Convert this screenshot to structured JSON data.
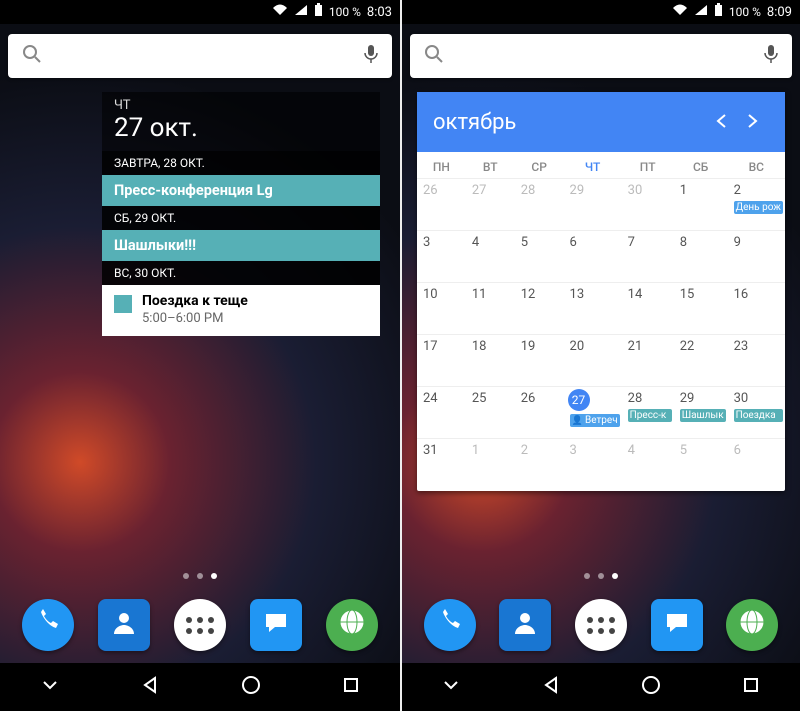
{
  "left": {
    "status": {
      "battery": "100 %",
      "time": "8:03"
    },
    "agenda": {
      "header_dow": "ЧТ",
      "header_date": "27 окт.",
      "sections": [
        {
          "label": "ЗАВТРА, 28 ОКТ.",
          "events": [
            {
              "type": "bar",
              "title": "Пресс-конференция Lg"
            }
          ]
        },
        {
          "label": "СБ, 29 ОКТ.",
          "events": [
            {
              "type": "bar",
              "title": "Шашлыки!!!"
            }
          ]
        },
        {
          "label": "ВС, 30 ОКТ.",
          "events": [
            {
              "type": "card",
              "title": "Поездка к теще",
              "time": "5:00–6:00 PM"
            }
          ]
        }
      ]
    }
  },
  "right": {
    "status": {
      "battery": "100 %",
      "time": "8:09"
    },
    "month": {
      "title": "октябрь",
      "weekdays": [
        "ПН",
        "ВТ",
        "СР",
        "ЧТ",
        "ПТ",
        "СБ",
        "ВС"
      ],
      "today_col": 3,
      "weeks": [
        [
          {
            "n": "26",
            "o": true
          },
          {
            "n": "27",
            "o": true
          },
          {
            "n": "28",
            "o": true
          },
          {
            "n": "29",
            "o": true
          },
          {
            "n": "30",
            "o": true
          },
          {
            "n": "1"
          },
          {
            "n": "2",
            "chips": [
              {
                "t": "День рож",
                "c": "blue"
              }
            ]
          }
        ],
        [
          {
            "n": "3"
          },
          {
            "n": "4"
          },
          {
            "n": "5"
          },
          {
            "n": "6"
          },
          {
            "n": "7"
          },
          {
            "n": "8"
          },
          {
            "n": "9"
          }
        ],
        [
          {
            "n": "10"
          },
          {
            "n": "11"
          },
          {
            "n": "12"
          },
          {
            "n": "13"
          },
          {
            "n": "14"
          },
          {
            "n": "15"
          },
          {
            "n": "16"
          }
        ],
        [
          {
            "n": "17"
          },
          {
            "n": "18"
          },
          {
            "n": "19"
          },
          {
            "n": "20"
          },
          {
            "n": "21"
          },
          {
            "n": "22"
          },
          {
            "n": "23"
          }
        ],
        [
          {
            "n": "24"
          },
          {
            "n": "25"
          },
          {
            "n": "26"
          },
          {
            "n": "27",
            "today": true,
            "chips": [
              {
                "t": "Ветреч",
                "c": "blue",
                "p": true
              }
            ]
          },
          {
            "n": "28",
            "chips": [
              {
                "t": "Пресс-к",
                "c": "teal"
              }
            ]
          },
          {
            "n": "29",
            "chips": [
              {
                "t": "Шашлык",
                "c": "teal"
              }
            ]
          },
          {
            "n": "30",
            "chips": [
              {
                "t": "Поездка",
                "c": "teal"
              }
            ]
          }
        ],
        [
          {
            "n": "31"
          },
          {
            "n": "1",
            "o": true
          },
          {
            "n": "2",
            "o": true
          },
          {
            "n": "3",
            "o": true
          },
          {
            "n": "4",
            "o": true
          },
          {
            "n": "5",
            "o": true
          },
          {
            "n": "6",
            "o": true
          }
        ]
      ]
    }
  },
  "dock": [
    "phone",
    "contacts",
    "drawer",
    "messages",
    "browser"
  ],
  "pages": {
    "count": 3,
    "active": 2
  }
}
